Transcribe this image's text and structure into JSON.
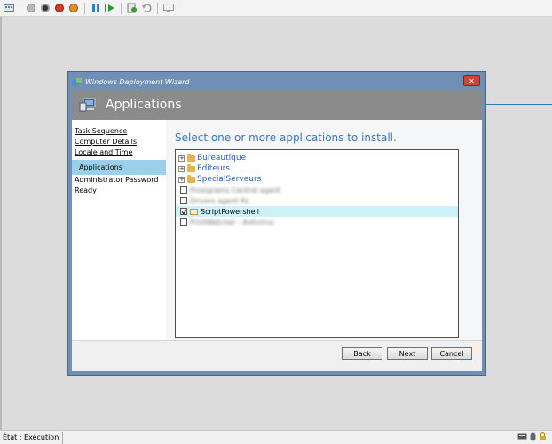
{
  "wizard": {
    "title": "Windows Deployment Wizard",
    "close_glyph": "✕",
    "header_title": "Applications",
    "nav": [
      {
        "label": "Task Sequence"
      },
      {
        "label": "Computer Details"
      },
      {
        "label": "Locale and Time"
      },
      {
        "label": "Applications"
      },
      {
        "label": "Administrator Password"
      },
      {
        "label": "Ready"
      }
    ],
    "main_heading": "Select one or more applications to install.",
    "tree": {
      "groups": [
        "Bureautique",
        "Editeurs",
        "SpecialServeurs"
      ],
      "apps": [
        {
          "label": "Proxigrams Central agent",
          "checked": false
        },
        {
          "label": "Drivers agent fix",
          "checked": false
        },
        {
          "label": "ScriptPowershell",
          "checked": true
        },
        {
          "label": "PrintWatcher - Antivirus",
          "checked": false
        }
      ]
    },
    "buttons": {
      "back": "Back",
      "next": "Next",
      "cancel": "Cancel"
    }
  },
  "status_bar": {
    "text": "État : Exécution"
  },
  "colors": {
    "accent": "#3d78b5",
    "header": "#8b8b8b",
    "selected": "#9cd0ea"
  }
}
